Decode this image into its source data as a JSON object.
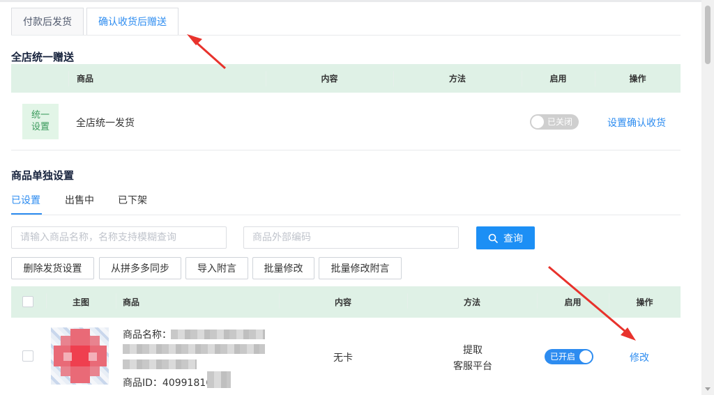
{
  "tabs": [
    "付款后发货",
    "确认收货后赠送"
  ],
  "store_section": {
    "title": "全店统一赠送",
    "columns": [
      "商品",
      "内容",
      "方法",
      "启用",
      "操作"
    ],
    "row": {
      "badge": "统一\n设置",
      "product": "全店统一发货",
      "toggle_label": "已关闭",
      "toggle_on": false,
      "action": "设置确认收货"
    }
  },
  "product_section": {
    "title": "商品单独设置",
    "subtabs": [
      "已设置",
      "出售中",
      "已下架"
    ],
    "active_subtab": 0,
    "search": {
      "name_placeholder": "请输入商品名称，名称支持模糊查询",
      "code_placeholder": "商品外部编码",
      "button_label": "查询"
    },
    "actions": [
      "删除发货设置",
      "从拼多多同步",
      "导入附言",
      "批量修改",
      "批量修改附言"
    ],
    "columns": [
      "主图",
      "商品",
      "内容",
      "方法",
      "启用",
      "操作"
    ],
    "rows": [
      {
        "name_label": "商品名称：",
        "id_label": "商品ID：40991816",
        "content": "无卡",
        "method_line1": "提取",
        "method_line2": "客服平台",
        "toggle_label": "已开启",
        "toggle_on": true,
        "action": "修改"
      }
    ]
  },
  "colors": {
    "accent": "#2d8cf0",
    "header_bg": "#dff1e6",
    "badge_bg": "#e2f5e7",
    "annotation_arrow": "#e8322c"
  }
}
